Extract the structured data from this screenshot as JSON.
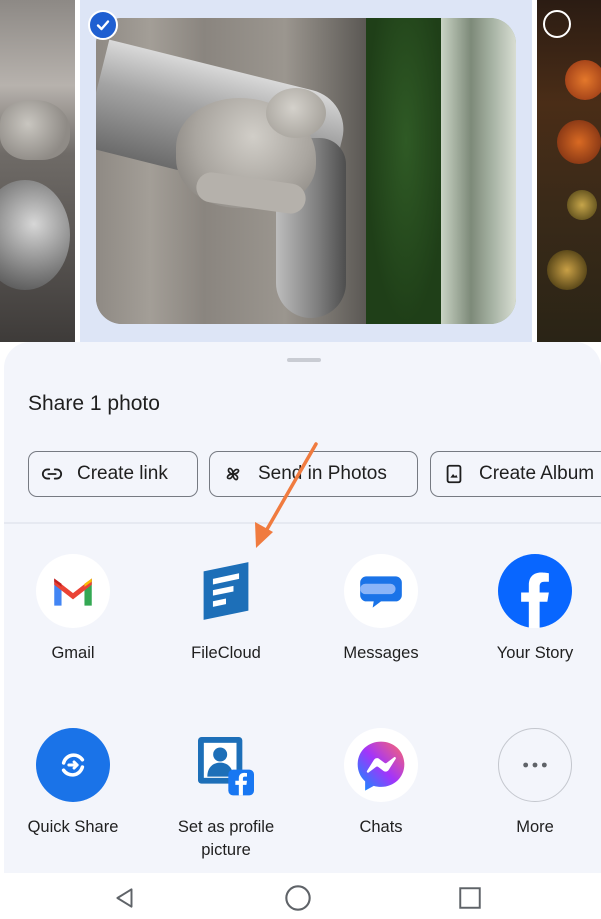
{
  "photos": {
    "selected_state": "selected",
    "accent_color": "#1f5fd1"
  },
  "sheet": {
    "title": "Share 1 photo",
    "background_color": "#f3f5fb"
  },
  "actions": [
    {
      "label": "Create link",
      "icon": "link-icon"
    },
    {
      "label": "Send in Photos",
      "icon": "pinwheel-icon"
    },
    {
      "label": "Create Album",
      "icon": "album-icon"
    }
  ],
  "apps": [
    {
      "label": "Gmail",
      "icon": "gmail-icon"
    },
    {
      "label": "FileCloud",
      "icon": "filecloud-icon"
    },
    {
      "label": "Messages",
      "icon": "messages-icon"
    },
    {
      "label": "Your Story",
      "icon": "facebook-icon"
    },
    {
      "label": "Quick Share",
      "icon": "quick-share-icon"
    },
    {
      "label": "Set as profile picture",
      "icon": "profile-picture-icon"
    },
    {
      "label": "Chats",
      "icon": "messenger-icon"
    },
    {
      "label": "More",
      "icon": "more-icon"
    }
  ],
  "annotation": {
    "type": "arrow",
    "color": "#f07b3f",
    "points_to": "FileCloud"
  },
  "navbar": {
    "buttons": [
      "back-icon",
      "home-icon",
      "recents-icon"
    ]
  }
}
